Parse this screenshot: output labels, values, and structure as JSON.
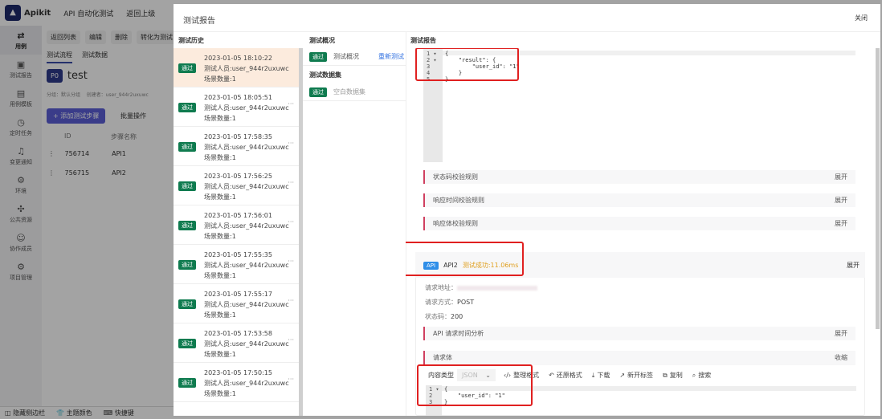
{
  "app": {
    "logo": "Apikit",
    "module": "API 自动化测试",
    "back": "返回上级",
    "sidebar": [
      {
        "icon": "switch-icon",
        "label": "用例",
        "active": true
      },
      {
        "icon": "report-icon",
        "label": "测试报告"
      },
      {
        "icon": "template-icon",
        "label": "用例模板"
      },
      {
        "icon": "timer-icon",
        "label": "定时任务"
      },
      {
        "icon": "bell-icon",
        "label": "变更通知"
      },
      {
        "icon": "env-icon",
        "label": "环境"
      },
      {
        "icon": "puzzle-icon",
        "label": "公共资源"
      },
      {
        "icon": "users-icon",
        "label": "协作成员"
      },
      {
        "icon": "gear-icon",
        "label": "项目管理"
      }
    ],
    "toolbar": [
      "返回列表",
      "编辑",
      "删除",
      "转化为测试"
    ],
    "tabs": [
      "测试流程",
      "测试数据"
    ],
    "case": {
      "badge": "P0",
      "title": "test",
      "meta": "分组：默认分组    创建者：user_944r2uxuwc"
    },
    "add_step": "+ 添加测试步骤",
    "batch": "批量操作",
    "table": {
      "headers": [
        "ID",
        "步骤名称"
      ],
      "rows": [
        [
          "756714",
          "API1"
        ],
        [
          "756715",
          "API2"
        ]
      ]
    },
    "bottom": [
      "隐藏侧边栏",
      "主题颜色",
      "快捷键"
    ]
  },
  "modal": {
    "title": "测试报告",
    "close": "关闭",
    "history_header": "测试历史",
    "overview_header": "测试概况",
    "report_header": "测试报告",
    "pass_label": "通过",
    "history": [
      {
        "time": "2023-01-05 18:10:22",
        "tester": "测试人员:user_944r2uxuwc",
        "scenes": "场景数量:1"
      },
      {
        "time": "2023-01-05 18:05:51",
        "tester": "测试人员:user_944r2uxuwc",
        "scenes": "场景数量:1"
      },
      {
        "time": "2023-01-05 17:58:35",
        "tester": "测试人员:user_944r2uxuwc",
        "scenes": "场景数量:1"
      },
      {
        "time": "2023-01-05 17:56:25",
        "tester": "测试人员:user_944r2uxuwc",
        "scenes": "场景数量:1"
      },
      {
        "time": "2023-01-05 17:56:01",
        "tester": "测试人员:user_944r2uxuwc",
        "scenes": "场景数量:1"
      },
      {
        "time": "2023-01-05 17:55:35",
        "tester": "测试人员:user_944r2uxuwc",
        "scenes": "场景数量:1"
      },
      {
        "time": "2023-01-05 17:55:17",
        "tester": "测试人员:user_944r2uxuwc",
        "scenes": "场景数量:1"
      },
      {
        "time": "2023-01-05 17:53:58",
        "tester": "测试人员:user_944r2uxuwc",
        "scenes": "场景数量:1"
      },
      {
        "time": "2023-01-05 17:50:15",
        "tester": "测试人员:user_944r2uxuwc",
        "scenes": "场景数量:1"
      }
    ],
    "overview": {
      "item": "测试概况",
      "retest": "重新测试",
      "dataset_header": "测试数据集",
      "dataset": "空白数据集"
    },
    "response_code": {
      "gutter": "1 ▾\n2 ▾\n3\n4\n5",
      "text": "{\n    \"result\": {\n        \"user_id\": \"1\"\n    }\n}"
    },
    "rules": [
      {
        "label": "状态码校验规则",
        "action": "展开"
      },
      {
        "label": "响应时间校验规则",
        "action": "展开"
      },
      {
        "label": "响应体校验规则",
        "action": "展开"
      }
    ],
    "api": {
      "badge": "API",
      "name": "API2",
      "status": "测试成功:11.06ms",
      "action": "展开",
      "url_label": "请求地址：",
      "method_label": "请求方式：",
      "method": "POST",
      "code_label": "状态码：",
      "code": "200",
      "timing": {
        "label": "API 请求时间分析",
        "action": "展开"
      },
      "body": {
        "label": "请求体",
        "action": "收缩",
        "content_type_label": "内容类型",
        "content_type": "JSON",
        "tools": [
          "整理格式",
          "还原格式",
          "下载",
          "新开标签",
          "复制",
          "搜索"
        ],
        "gutter": "1 ▾\n2\n3",
        "text": "{\n    \"user_id\": \"1\"\n}"
      }
    }
  }
}
